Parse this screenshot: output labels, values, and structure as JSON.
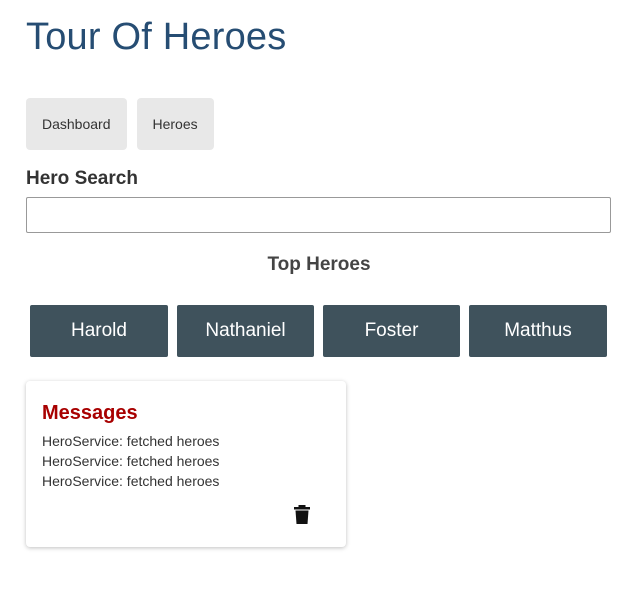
{
  "app": {
    "title": "Tour Of Heroes"
  },
  "nav": {
    "items": [
      {
        "label": "Dashboard"
      },
      {
        "label": "Heroes"
      }
    ]
  },
  "search": {
    "label": "Hero Search",
    "value": "",
    "placeholder": ""
  },
  "top_heroes": {
    "title": "Top Heroes",
    "heroes": [
      {
        "name": "Harold"
      },
      {
        "name": "Nathaniel"
      },
      {
        "name": "Foster"
      },
      {
        "name": "Matthus"
      }
    ]
  },
  "messages": {
    "title": "Messages",
    "items": [
      "HeroService: fetched heroes",
      "HeroService: fetched heroes",
      "HeroService: fetched heroes"
    ],
    "clear_icon": "trash-icon"
  },
  "colors": {
    "title": "#264d73",
    "nav_bg": "#e8e8e8",
    "hero_tile_bg": "#3f525c",
    "messages_title": "#a80000"
  }
}
